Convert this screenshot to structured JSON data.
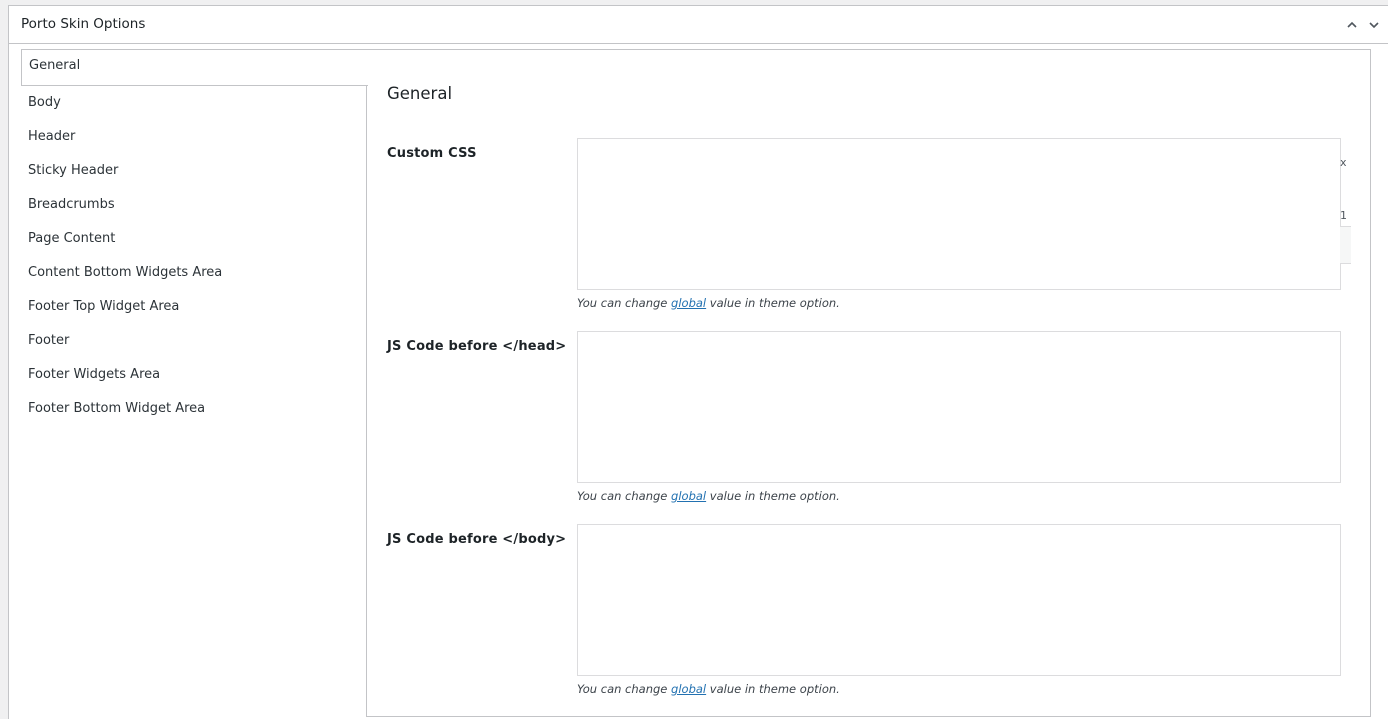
{
  "metabox": {
    "title": "Porto Skin Options",
    "collapse_up_icon": "chevron-up-icon",
    "collapse_down_icon": "chevron-down-icon"
  },
  "tabs": [
    {
      "label": "General",
      "active": true
    },
    {
      "label": "Body"
    },
    {
      "label": "Header"
    },
    {
      "label": "Sticky Header"
    },
    {
      "label": "Breadcrumbs"
    },
    {
      "label": "Page Content"
    },
    {
      "label": "Content Bottom Widgets Area"
    },
    {
      "label": "Footer Top Widget Area"
    },
    {
      "label": "Footer"
    },
    {
      "label": "Footer Widgets Area"
    },
    {
      "label": "Footer Bottom Widget Area"
    }
  ],
  "section": {
    "title": "General"
  },
  "fields": [
    {
      "label": "Custom CSS",
      "value": "",
      "desc_prefix": "You can change ",
      "desc_link": "global",
      "desc_suffix": " value in theme option."
    },
    {
      "label": "JS Code before </head>",
      "value": "",
      "desc_prefix": "You can change ",
      "desc_link": "global",
      "desc_suffix": " value in theme option."
    },
    {
      "label": "JS Code before </body>",
      "value": "",
      "desc_prefix": "You can change ",
      "desc_link": "global",
      "desc_suffix": " value in theme option."
    }
  ],
  "stray": {
    "x_glyph": "x",
    "one_glyph": "1"
  },
  "colors": {
    "link": "#2271b1",
    "border": "#c3c4c7",
    "text": "#1d2327",
    "background": "#f0f0f1"
  }
}
